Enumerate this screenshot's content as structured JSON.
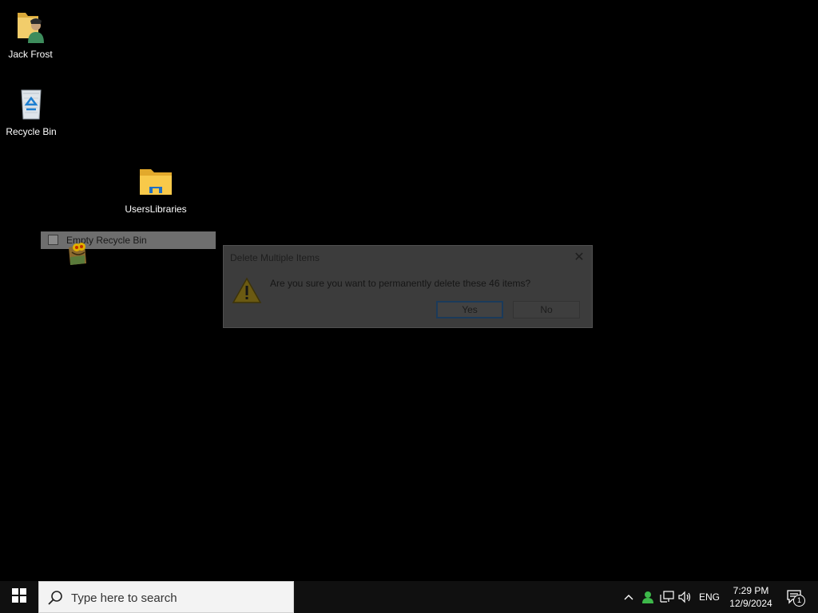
{
  "desktop": {
    "icons": [
      {
        "label": "Jack Frost",
        "icon": "user-folder-icon"
      },
      {
        "label": "Recycle Bin",
        "icon": "recycle-bin-icon"
      },
      {
        "label": "UsersLibraries",
        "icon": "folder-icon"
      }
    ]
  },
  "context_menu": {
    "item_label": "Empty Recycle Bin"
  },
  "dialog": {
    "title": "Delete Multiple Items",
    "message": "Are you sure you want to permanently delete these 46 items?",
    "yes_label": "Yes",
    "no_label": "No",
    "icon": "warning-icon"
  },
  "taskbar": {
    "search_placeholder": "Type here to search",
    "language": "ENG",
    "time": "7:29 PM",
    "date": "12/9/2024",
    "notification_count": "1"
  },
  "colors": {
    "taskbar": "#101010",
    "desktop": "#000000",
    "folder": "#f5c542"
  }
}
